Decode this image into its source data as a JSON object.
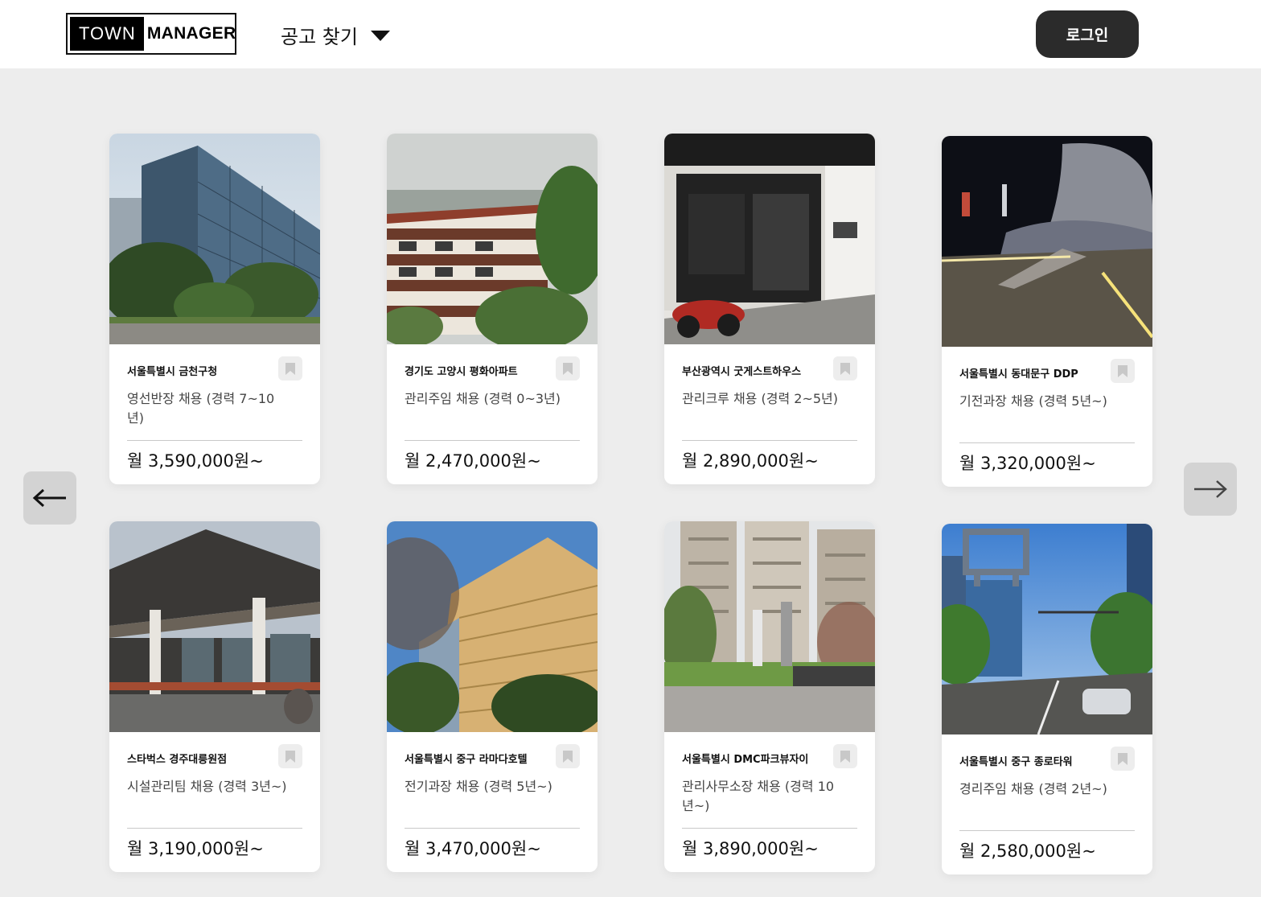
{
  "header": {
    "logo_left": "TOWN",
    "logo_right": "MANAGER",
    "nav_menu_label": "공고 찾기",
    "login_label": "로그인"
  },
  "icons": {
    "nav_dropdown": "caret-down-icon",
    "prev": "arrow-left-icon",
    "next": "arrow-right-icon",
    "bookmark": "bookmark-icon"
  },
  "colors": {
    "page_background": "#ededed",
    "header_background": "#ffffff",
    "login_button": "#2b2b2b",
    "arrow_button": "#d3d3d3",
    "bookmark_button": "#ededed"
  },
  "listings": [
    {
      "place": "서울특별시 금천구청",
      "job": "영선반장 채용 (경력 7~10년)",
      "salary": "월 3,590,000원~",
      "photo": "photo-office-tower"
    },
    {
      "place": "경기도 고양시 평화아파트",
      "job": "관리주임 채용 (경력 0~3년)",
      "salary": "월 2,470,000원~",
      "photo": "photo-brick-apartment"
    },
    {
      "place": "부산광역시 굿게스트하우스",
      "job": "관리크루 채용 (경력 2~5년)",
      "salary": "월 2,890,000원~",
      "photo": "photo-guesthouse-entrance"
    },
    {
      "place": "서울특별시 동대문구 DDP",
      "job": "기전과장 채용 (경력 5년~)",
      "salary": "월 3,320,000원~",
      "photo": "photo-ddp-night"
    },
    {
      "place": "스타벅스 경주대릉원점",
      "job": "시설관리팀 채용 (경력 3년~)",
      "salary": "월 3,190,000원~",
      "photo": "photo-hanok-cafe"
    },
    {
      "place": "서울특별시 중구 라마다호텔",
      "job": "전기과장 채용 (경력 5년~)",
      "salary": "월 3,470,000원~",
      "photo": "photo-hotel-tower"
    },
    {
      "place": "서울특별시 DMC파크뷰자이",
      "job": "관리사무소장 채용 (경력 10년~)",
      "salary": "월 3,890,000원~",
      "photo": "photo-apartment-plaza"
    },
    {
      "place": "서울특별시 중구 종로타워",
      "job": "경리주임 채용 (경력 2년~)",
      "salary": "월 2,580,000원~",
      "photo": "photo-jongno-tower"
    }
  ]
}
